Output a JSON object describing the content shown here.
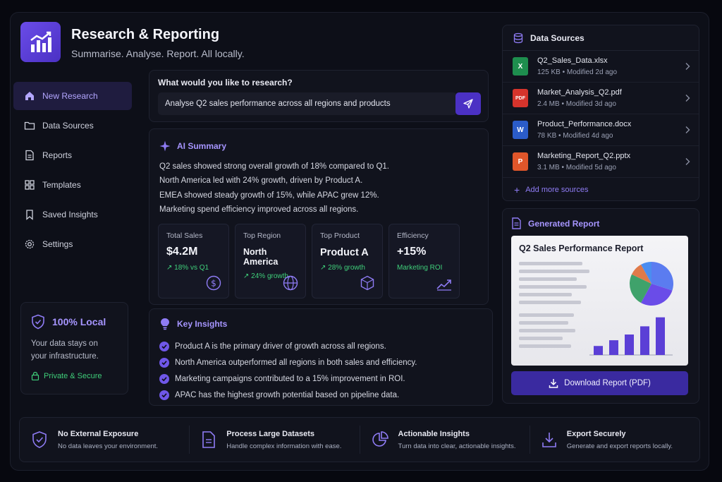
{
  "app": {
    "title": "Research & Reporting",
    "subtitle": "Summarise. Analyse. Report. All locally."
  },
  "sidebar": {
    "items": [
      {
        "label": "New Research",
        "icon": "home-icon",
        "active": true
      },
      {
        "label": "Data Sources",
        "icon": "folder-icon"
      },
      {
        "label": "Reports",
        "icon": "document-icon"
      },
      {
        "label": "Templates",
        "icon": "grid-icon"
      },
      {
        "label": "Saved Insights",
        "icon": "bookmark-icon"
      },
      {
        "label": "Settings",
        "icon": "gear-icon"
      }
    ],
    "local": {
      "title": "100% Local",
      "text": "Your data stays on your infrastructure.",
      "secure": "Private & Secure"
    }
  },
  "research": {
    "label": "What would you like to research?",
    "query": "Analyse Q2 sales performance across all regions and products"
  },
  "summary": {
    "title": "AI Summary",
    "lines": [
      "Q2 sales showed strong overall growth of 18% compared to Q1.",
      "North America led with 24% growth, driven by Product A.",
      "EMEA showed steady growth of 15%, while APAC grew 12%.",
      "Marketing spend efficiency improved across all regions."
    ],
    "metrics": [
      {
        "label": "Total Sales",
        "value": "$4.2M",
        "change": "↗ 18% vs Q1",
        "icon": "dollar-icon"
      },
      {
        "label": "Top Region",
        "value": "North America",
        "change": "↗ 24% growth",
        "icon": "globe-icon"
      },
      {
        "label": "Top Product",
        "value": "Product A",
        "change": "↗ 28% growth",
        "icon": "cube-icon"
      },
      {
        "label": "Efficiency",
        "value": "+15%",
        "change": "Marketing ROI",
        "icon": "trend-icon"
      }
    ]
  },
  "insights": {
    "title": "Key Insights",
    "items": [
      "Product A is the primary driver of growth across all regions.",
      "North America outperformed all regions in both sales and efficiency.",
      "Marketing campaigns contributed to a 15% improvement in ROI.",
      "APAC has the highest growth potential based on pipeline data."
    ]
  },
  "sources": {
    "title": "Data Sources",
    "files": [
      {
        "name": "Q2_Sales_Data.xlsx",
        "meta": "125 KB • Modified 2d ago",
        "type": "X",
        "color": "#1e8e4e"
      },
      {
        "name": "Market_Analysis_Q2.pdf",
        "meta": "2.4 MB • Modified 3d ago",
        "type": "PDF",
        "color": "#d6342c"
      },
      {
        "name": "Product_Performance.docx",
        "meta": "78 KB • Modified 4d ago",
        "type": "W",
        "color": "#2b5cc8"
      },
      {
        "name": "Marketing_Report_Q2.pptx",
        "meta": "3.1 MB • Modified 5d ago",
        "type": "P",
        "color": "#e0562a"
      }
    ],
    "add_label": "Add more sources"
  },
  "report": {
    "title": "Generated Report",
    "preview_title": "Q2 Sales Performance Report",
    "bars": [
      0.22,
      0.36,
      0.5,
      0.7,
      0.92
    ],
    "pie": [
      0.3,
      0.28,
      0.24,
      0.1,
      0.08
    ],
    "download_label": "Download Report (PDF)"
  },
  "features": [
    {
      "title": "No External Exposure",
      "text": "No data leaves your environment.",
      "icon": "shield-icon"
    },
    {
      "title": "Process Large Datasets",
      "text": "Handle complex information with ease.",
      "icon": "file-icon"
    },
    {
      "title": "Actionable Insights",
      "text": "Turn data into clear, actionable insights.",
      "icon": "pie-chart-icon"
    },
    {
      "title": "Export Securely",
      "text": "Generate and export reports locally.",
      "icon": "download-icon"
    }
  ],
  "colors": {
    "accent": "#6a4ce8",
    "accent_text": "#8f7cf5",
    "positive": "#3fcf7a",
    "background": "#0d0f18"
  }
}
